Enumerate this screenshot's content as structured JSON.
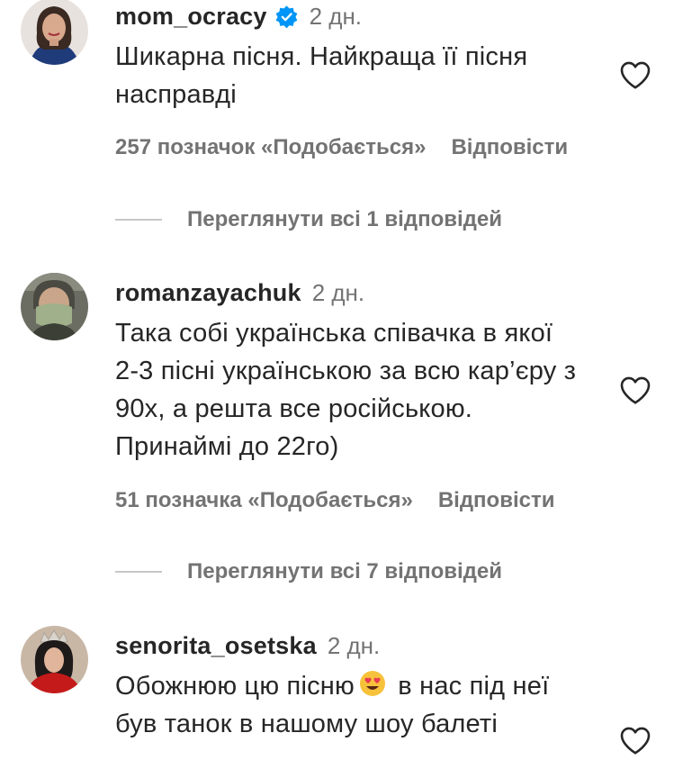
{
  "comments": [
    {
      "username": "mom_ocracy",
      "verified": true,
      "time": "2 дн.",
      "text": "Шикарна пісня. Найкраща її пісня насправді",
      "likes": "257 позначок «Подобається»",
      "reply": "Відповісти",
      "view_replies": "Переглянути всі 1 відповідей"
    },
    {
      "username": "romanzayachuk",
      "verified": false,
      "time": "2 дн.",
      "text": "Така собі українська співачка в якої 2-3 пісні українською за всю кар’єру з 90х, а решта все російською. Принаймі до 22го)",
      "likes": "51 позначка «Подобається»",
      "reply": "Відповісти",
      "view_replies": "Переглянути всі 7 відповідей"
    },
    {
      "username": "senorita_osetska",
      "verified": false,
      "time": "2 дн.",
      "text_part1": "Обожнюю цю пісню",
      "text_part2": " в нас під неї був танок в нашому шоу балеті"
    }
  ],
  "icons": {
    "verified": "verified-badge-icon",
    "like": "heart-outline-icon",
    "emoji": "heart-eyes-emoji"
  },
  "colors": {
    "username": "#262626",
    "secondary": "#737373",
    "verified": "#0095f6",
    "divider": "#c7c7c7"
  }
}
